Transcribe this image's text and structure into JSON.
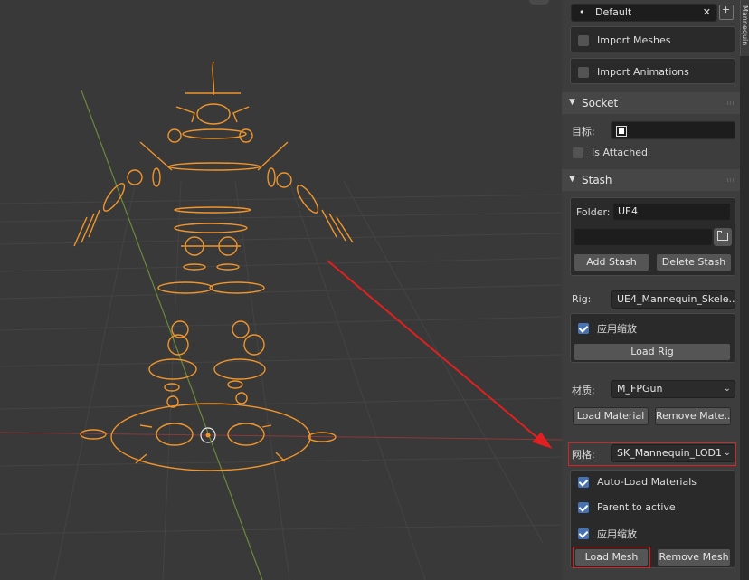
{
  "preset": {
    "bullet": "•",
    "value": "Default",
    "clear": "✕"
  },
  "import": {
    "meshes": "Import Meshes",
    "animations": "Import Animations"
  },
  "socket": {
    "title": "Socket",
    "target_label": "目标:",
    "is_attached": "Is Attached"
  },
  "stash": {
    "title": "Stash",
    "folder_label": "Folder:",
    "folder_value": "UE4",
    "add_button": "Add Stash",
    "delete_button": "Delete Stash"
  },
  "rig": {
    "label": "Rig:",
    "value": "UE4_Mannequin_Skele...",
    "apply_scale": "应用缩放",
    "load_button": "Load Rig"
  },
  "material": {
    "label": "材质:",
    "value": "M_FPGun",
    "load_button": "Load Material",
    "remove_button": "Remove Mate..."
  },
  "mesh": {
    "label": "网格:",
    "value": "SK_Mannequin_LOD1",
    "auto_load": "Auto-Load Materials",
    "parent_active": "Parent to active",
    "apply_scale": "应用缩放",
    "load_button": "Load Mesh",
    "remove_button": "Remove Mesh"
  },
  "side_tab": "Mr Mannequin",
  "colors": {
    "accent": "#4772b3",
    "rig_orange": "#f0952b",
    "annotation_red": "#e02020"
  }
}
